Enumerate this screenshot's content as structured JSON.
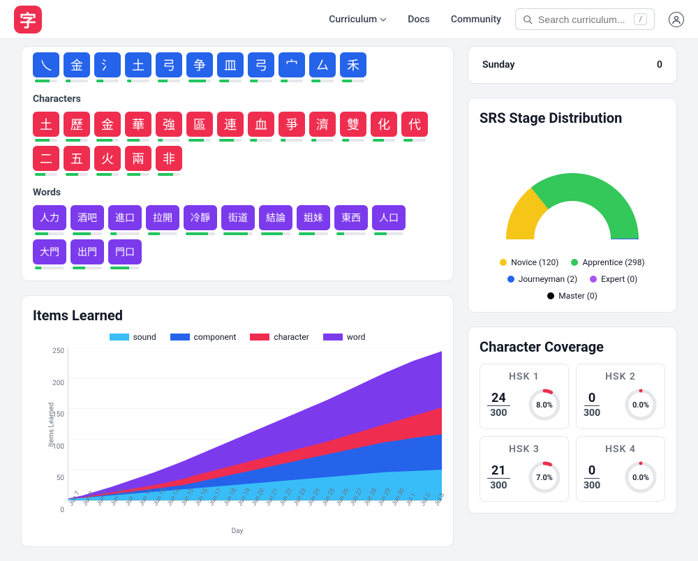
{
  "nav": {
    "logo_char": "字",
    "curriculum": "Curriculum",
    "docs": "Docs",
    "community": "Community",
    "search_placeholder": "Search curriculum...",
    "shortcut": "/"
  },
  "components": {
    "items": [
      "乀",
      "金",
      "氵",
      "土",
      "弓",
      "争",
      "皿",
      "弓",
      "宀",
      "厶",
      "禾"
    ]
  },
  "characters": {
    "title": "Characters",
    "items": [
      "土",
      "歷",
      "金",
      "華",
      "強",
      "區",
      "連",
      "血",
      "爭",
      "濟",
      "雙",
      "化",
      "代",
      "二",
      "五",
      "火",
      "兩",
      "非"
    ]
  },
  "words": {
    "title": "Words",
    "items": [
      "人力",
      "酒吧",
      "進口",
      "拉開",
      "冷靜",
      "街道",
      "結論",
      "姐妹",
      "東西",
      "人口",
      "大門",
      "出門",
      "門口"
    ]
  },
  "weekdays": {
    "items": [
      {
        "label": "Sunday",
        "value": 0
      }
    ]
  },
  "srs": {
    "title": "SRS Stage Distribution",
    "legend": [
      {
        "label": "Novice (120)",
        "color": "#f5c518"
      },
      {
        "label": "Apprentice (298)",
        "color": "#34c759"
      },
      {
        "label": "Journeyman (2)",
        "color": "#2563eb"
      },
      {
        "label": "Expert (0)",
        "color": "#a855f7"
      },
      {
        "label": "Master (0)",
        "color": "#000000"
      }
    ]
  },
  "items_learned": {
    "title": "Items Learned",
    "y_label": "Items Learned",
    "x_label": "Day",
    "legend": [
      {
        "label": "sound",
        "color": "#38bdf8"
      },
      {
        "label": "component",
        "color": "#2563eb"
      },
      {
        "label": "character",
        "color": "#ef2e4f"
      },
      {
        "label": "word",
        "color": "#7c3aed"
      }
    ],
    "y_ticks": [
      "250",
      "200",
      "150",
      "100",
      "50",
      "0"
    ],
    "x_ticks": [
      "Jun 7",
      "Jun 8",
      "Jun 9",
      "Jun 10",
      "Jun 11",
      "Jun 12",
      "Jun 13",
      "Jun 14",
      "Jun 15",
      "Jun 16",
      "Jun 17",
      "Jun 18",
      "Jun 19",
      "Jun 20",
      "Jun 21",
      "Jun 22",
      "Jun 23",
      "Jun 24",
      "Jun 25",
      "Jun 26",
      "Jun 27",
      "Jun 28",
      "Jun 29",
      "Jun 30",
      "Jul 1",
      "Jul 2",
      "Jul 3"
    ]
  },
  "coverage": {
    "title": "Character Coverage",
    "cards": [
      {
        "title": "HSK 1",
        "num": "24",
        "den": "300",
        "pct": "8.0%",
        "frac": 0.08
      },
      {
        "title": "HSK 2",
        "num": "0",
        "den": "300",
        "pct": "0.0%",
        "frac": 0.0
      },
      {
        "title": "HSK 3",
        "num": "21",
        "den": "300",
        "pct": "7.0%",
        "frac": 0.07
      },
      {
        "title": "HSK 4",
        "num": "0",
        "den": "300",
        "pct": "0.0%",
        "frac": 0.0
      }
    ]
  },
  "chart_data": [
    {
      "type": "area",
      "title": "Items Learned",
      "xlabel": "Day",
      "ylabel": "Items Learned",
      "ylim": [
        0,
        250
      ],
      "x": [
        "Jun 7",
        "Jun 8",
        "Jun 9",
        "Jun 10",
        "Jun 11",
        "Jun 12",
        "Jun 13",
        "Jun 14",
        "Jun 15",
        "Jun 16",
        "Jun 17",
        "Jun 18",
        "Jun 19",
        "Jun 20",
        "Jun 21",
        "Jun 22",
        "Jun 23",
        "Jun 24",
        "Jun 25",
        "Jun 26",
        "Jun 27",
        "Jun 28",
        "Jun 29",
        "Jun 30",
        "Jul 1",
        "Jul 2",
        "Jul 3"
      ],
      "series": [
        {
          "name": "sound",
          "color": "#38bdf8",
          "values": [
            2,
            4,
            6,
            8,
            10,
            12,
            14,
            16,
            18,
            20,
            22,
            24,
            26,
            28,
            30,
            32,
            34,
            36,
            38,
            40,
            42,
            44,
            46,
            47,
            48,
            49,
            50
          ]
        },
        {
          "name": "component",
          "color": "#2563eb",
          "values": [
            2,
            4,
            7,
            10,
            13,
            16,
            19,
            22,
            25,
            30,
            35,
            40,
            45,
            50,
            55,
            60,
            65,
            70,
            75,
            80,
            85,
            90,
            95,
            98,
            102,
            105,
            108
          ]
        },
        {
          "name": "character",
          "color": "#ef2e4f",
          "values": [
            2,
            5,
            9,
            13,
            17,
            21,
            25,
            30,
            35,
            42,
            48,
            54,
            60,
            66,
            72,
            78,
            84,
            90,
            96,
            103,
            110,
            117,
            124,
            131,
            138,
            145,
            152
          ]
        },
        {
          "name": "word",
          "color": "#7c3aed",
          "values": [
            3,
            8,
            15,
            22,
            30,
            38,
            46,
            55,
            64,
            74,
            84,
            94,
            104,
            114,
            124,
            134,
            144,
            154,
            164,
            175,
            186,
            197,
            208,
            218,
            228,
            236,
            244
          ]
        }
      ]
    },
    {
      "type": "pie",
      "title": "SRS Stage Distribution",
      "series": [
        {
          "name": "Novice",
          "value": 120,
          "color": "#f5c518"
        },
        {
          "name": "Apprentice",
          "value": 298,
          "color": "#34c759"
        },
        {
          "name": "Journeyman",
          "value": 2,
          "color": "#2563eb"
        },
        {
          "name": "Expert",
          "value": 0,
          "color": "#a855f7"
        },
        {
          "name": "Master",
          "value": 0,
          "color": "#000000"
        }
      ]
    }
  ]
}
